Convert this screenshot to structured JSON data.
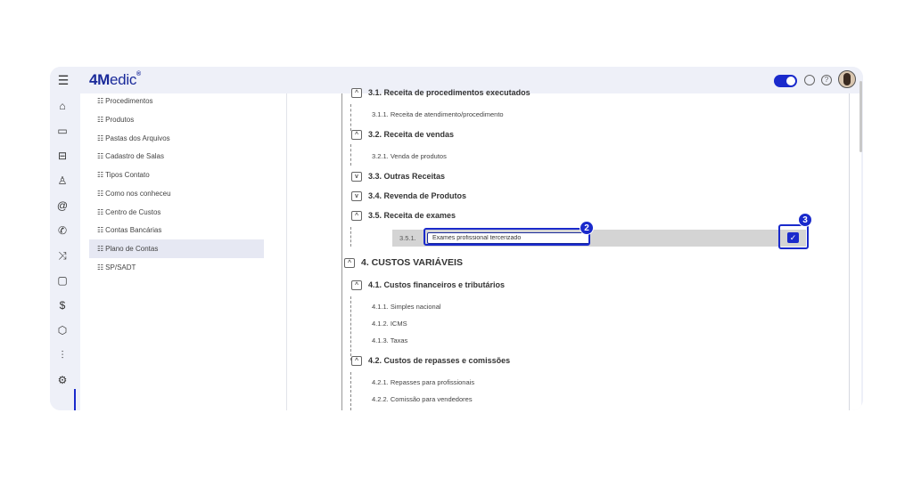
{
  "app": {
    "logo_bold": "4M",
    "logo_rest": "edic",
    "logo_mark": "®"
  },
  "topbar_icons": [
    "menu-icon",
    "toggle-switch",
    "chat-icon",
    "help-icon",
    "avatar"
  ],
  "nav_icons": [
    "home-icon",
    "calendar-icon",
    "inbox-icon",
    "user-icon",
    "at-icon",
    "phone-icon",
    "shuffle-icon",
    "clipboard-icon",
    "dollar-icon",
    "box-icon",
    "chart-icon",
    "gear-icon"
  ],
  "submenu": {
    "items": [
      {
        "label": "Procedimentos"
      },
      {
        "label": "Produtos"
      },
      {
        "label": "Pastas dos Arquivos"
      },
      {
        "label": "Cadastro de Salas"
      },
      {
        "label": "Tipos Contato"
      },
      {
        "label": "Como nos conheceu"
      },
      {
        "label": "Centro de Custos"
      },
      {
        "label": "Contas Bancárias"
      },
      {
        "label": "Plano de Contas"
      },
      {
        "label": "SP/SADT"
      }
    ],
    "active_index": 8
  },
  "tree": {
    "n31": "3.1. Receita de procedimentos executados",
    "n311": "3.1.1. Receita de atendimento/procedimento",
    "n32": "3.2. Receita de vendas",
    "n321": "3.2.1. Venda de produtos",
    "n33": "3.3. Outras Receitas",
    "n34": "3.4. Revenda de Produtos",
    "n35": "3.5. Receita de exames",
    "edit_code": "3.5.1.",
    "edit_value": "Exames profissional tercerizado",
    "section4": "4. CUSTOS VARIÁVEIS",
    "n41": "4.1. Custos financeiros e tributários",
    "n411": "4.1.1. Simples nacional",
    "n412": "4.1.2. ICMS",
    "n413": "4.1.3. Taxas",
    "n42": "4.2. Custos de repasses e comissões",
    "n421": "4.2.1. Repasses para profissionais",
    "n422": "4.2.2. Comissão para vendedores"
  },
  "toggles": {
    "collapse": "^",
    "expand": "v"
  },
  "annotations": {
    "badge_2": "2",
    "badge_3": "3"
  },
  "colors": {
    "accent": "#1a2acc",
    "brand": "#1a2a9a",
    "edit_row_bg": "#d4d4d4"
  }
}
